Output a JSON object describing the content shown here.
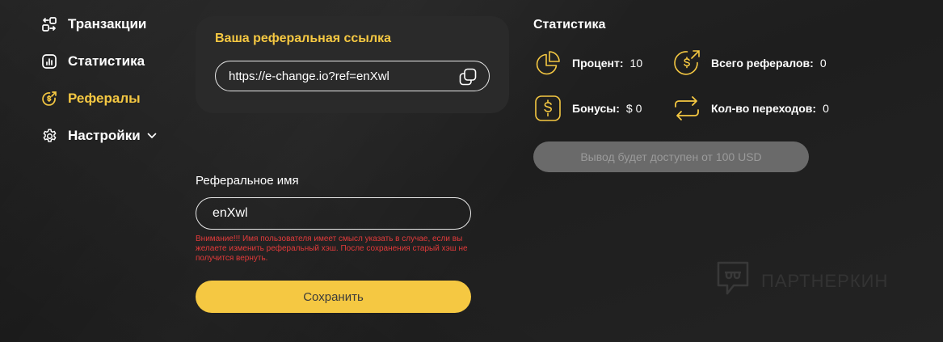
{
  "sidebar": {
    "items": [
      {
        "label": "Транзакции",
        "icon": "transactions-icon"
      },
      {
        "label": "Статистика",
        "icon": "statistics-icon"
      },
      {
        "label": "Рефералы",
        "icon": "referrals-icon"
      },
      {
        "label": "Настройки",
        "icon": "settings-icon"
      }
    ],
    "active_item": "Рефералы"
  },
  "referral_link": {
    "title": "Ваша реферальная ссылка",
    "value": "https://e-change.io?ref=enXwl",
    "copy_icon": "copy-icon"
  },
  "referral_name": {
    "label": "Реферальное имя",
    "value": "enXwl",
    "warning": "Внимание!!! Имя пользователя имеет смысл указать в случае, если вы желаете изменить реферальный хэш. После сохранения старый хэш не получится вернуть.",
    "save_label": "Сохранить"
  },
  "statistics": {
    "title": "Статистика",
    "percent": {
      "label": "Процент:",
      "value": "10",
      "icon": "pie-chart-icon"
    },
    "total_referrals": {
      "label": "Всего рефералов:",
      "value": "0",
      "icon": "dollar-coin-arrow-icon"
    },
    "bonuses": {
      "label": "Бонусы:",
      "value": "$ 0",
      "icon": "dollar-card-icon"
    },
    "clicks": {
      "label": "Кол-во переходов:",
      "value": "0",
      "icon": "repeat-arrows-icon"
    },
    "withdraw_label": "Вывод будет доступен от 100 USD"
  },
  "watermark": {
    "text": "ПАРТНЕРКИН",
    "icon": "partnerkin-logo-icon"
  },
  "colors": {
    "accent": "#f5c842",
    "background": "#202020",
    "card": "#2a2a2a",
    "warning": "#e23a3a",
    "disabled": "#6a6a6a"
  }
}
